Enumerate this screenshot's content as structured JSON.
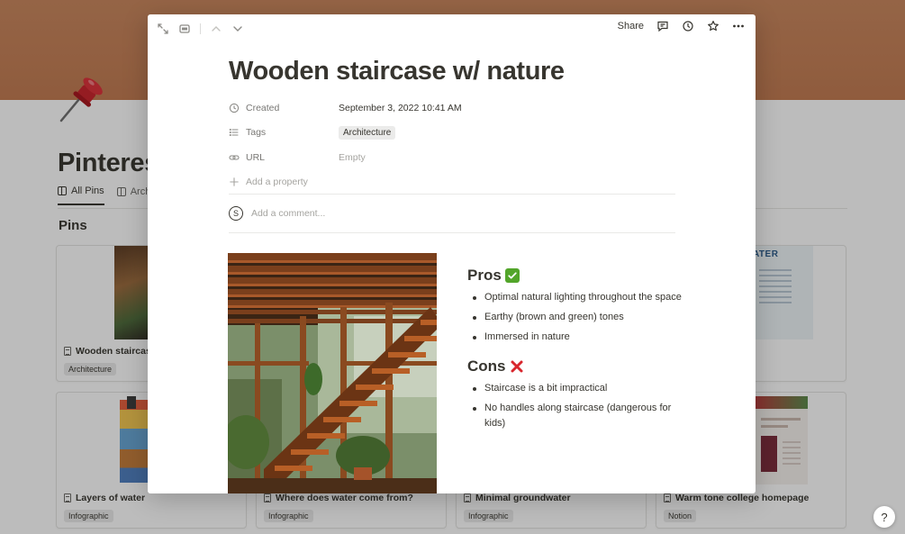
{
  "background": {
    "page_title": "Pinteres",
    "tabs": [
      {
        "label": "All Pins",
        "active": true
      },
      {
        "label": "Arch",
        "active": false
      }
    ],
    "section_title": "Pins",
    "cards": [
      {
        "name": "Wooden staircase",
        "tag": "Architecture"
      },
      {
        "name": "Layers of water",
        "tag": "Infographic"
      },
      {
        "name": "Where does water come from?",
        "tag": "Infographic"
      },
      {
        "name": "Minimal groundwater",
        "tag": "Infographic"
      },
      {
        "name": "Warm tone college homepage",
        "tag": "Notion"
      }
    ],
    "card_text_fragment": "G WATER",
    "help_label": "?"
  },
  "modal": {
    "toolbar": {
      "share_label": "Share"
    },
    "title": "Wooden staircase w/ nature",
    "properties": [
      {
        "key": "Created",
        "icon": "clock-icon",
        "value": "September 3, 2022 10:41 AM",
        "type": "text"
      },
      {
        "key": "Tags",
        "icon": "list-icon",
        "value": "Architecture",
        "type": "tag"
      },
      {
        "key": "URL",
        "icon": "link-icon",
        "value": "Empty",
        "type": "empty"
      }
    ],
    "add_property_label": "Add a property",
    "comment": {
      "avatar_letter": "S",
      "placeholder": "Add a comment..."
    },
    "pros": {
      "heading": "Pros",
      "items": [
        "Optimal natural lighting throughout the space",
        "Earthy (brown and green) tones",
        "Immersed in nature"
      ]
    },
    "cons": {
      "heading": "Cons",
      "items": [
        "Staircase is a bit impractical",
        "No handles along staircase (dangerous for kids)"
      ]
    }
  },
  "colors": {
    "cover": "#c27a50",
    "text": "#37352f",
    "muted": "#787774",
    "check": "#52a52a",
    "cross": "#d8262d"
  }
}
